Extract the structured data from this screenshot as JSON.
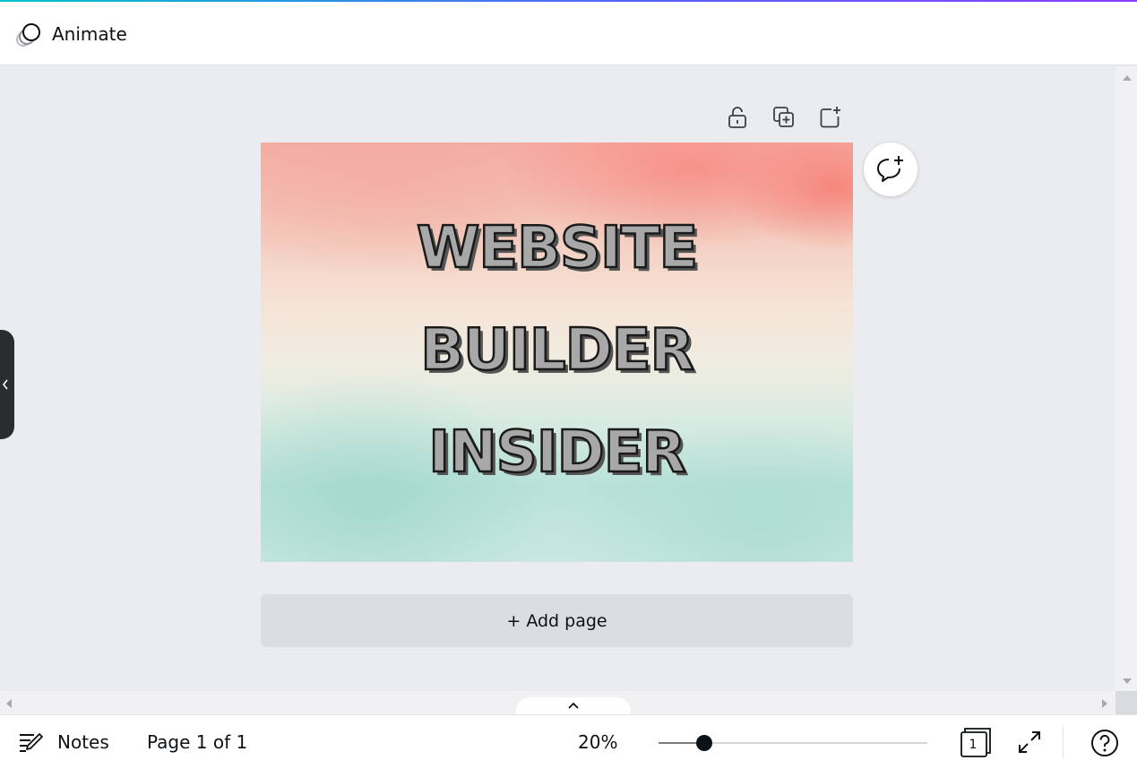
{
  "header": {
    "animate_label": "Animate"
  },
  "design": {
    "lines": [
      "WEBSITE",
      "BUILDER",
      "INSIDER"
    ]
  },
  "page_tools": {
    "lock_icon": "unlock-icon",
    "duplicate_icon": "duplicate-page-icon",
    "add_icon": "add-page-icon"
  },
  "comment_icon": "add-comment-icon",
  "add_page_label": "+ Add page",
  "footer": {
    "notes_label": "Notes",
    "page_indicator": "Page 1 of 1",
    "zoom_label": "20%",
    "zoom_level": 0.17,
    "page_count": "1"
  }
}
